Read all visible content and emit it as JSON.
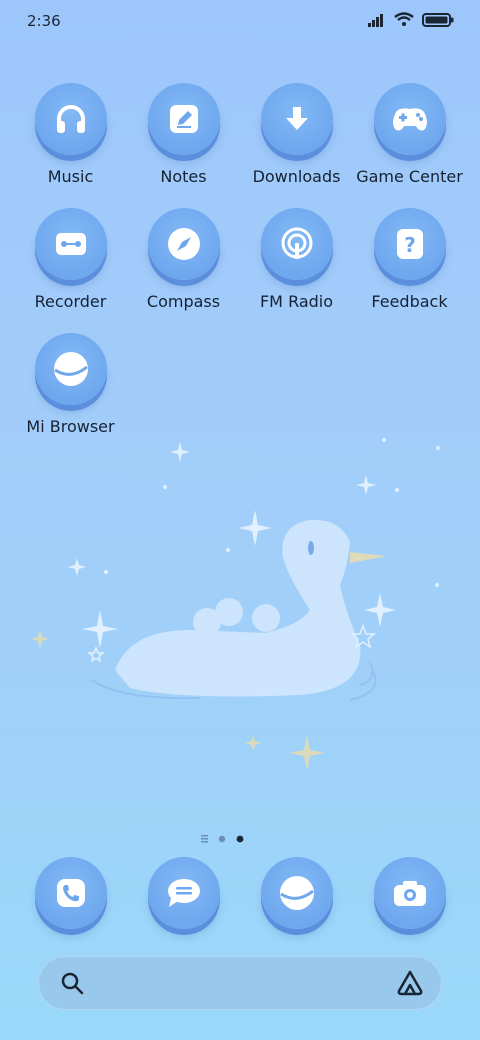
{
  "status_bar": {
    "time": "2:36"
  },
  "apps": [
    {
      "label": "Music",
      "icon": "headphones-icon"
    },
    {
      "label": "Notes",
      "icon": "pencil-note-icon"
    },
    {
      "label": "Downloads",
      "icon": "download-arrow-icon"
    },
    {
      "label": "Game Center",
      "icon": "gamepad-icon"
    },
    {
      "label": "Recorder",
      "icon": "recorder-icon"
    },
    {
      "label": "Compass",
      "icon": "compass-icon"
    },
    {
      "label": "FM Radio",
      "icon": "radio-icon"
    },
    {
      "label": "Feedback",
      "icon": "question-icon"
    },
    {
      "label": "Mi Browser",
      "icon": "planet-icon"
    }
  ],
  "dock": [
    {
      "icon": "phone-icon"
    },
    {
      "icon": "messages-icon"
    },
    {
      "icon": "browser-icon"
    },
    {
      "icon": "camera-icon"
    }
  ],
  "pager": {
    "pages": 2,
    "active": 2
  },
  "colors": {
    "accent": "#6fa7ef",
    "background": "#9dc7fb",
    "text": "#162233"
  }
}
